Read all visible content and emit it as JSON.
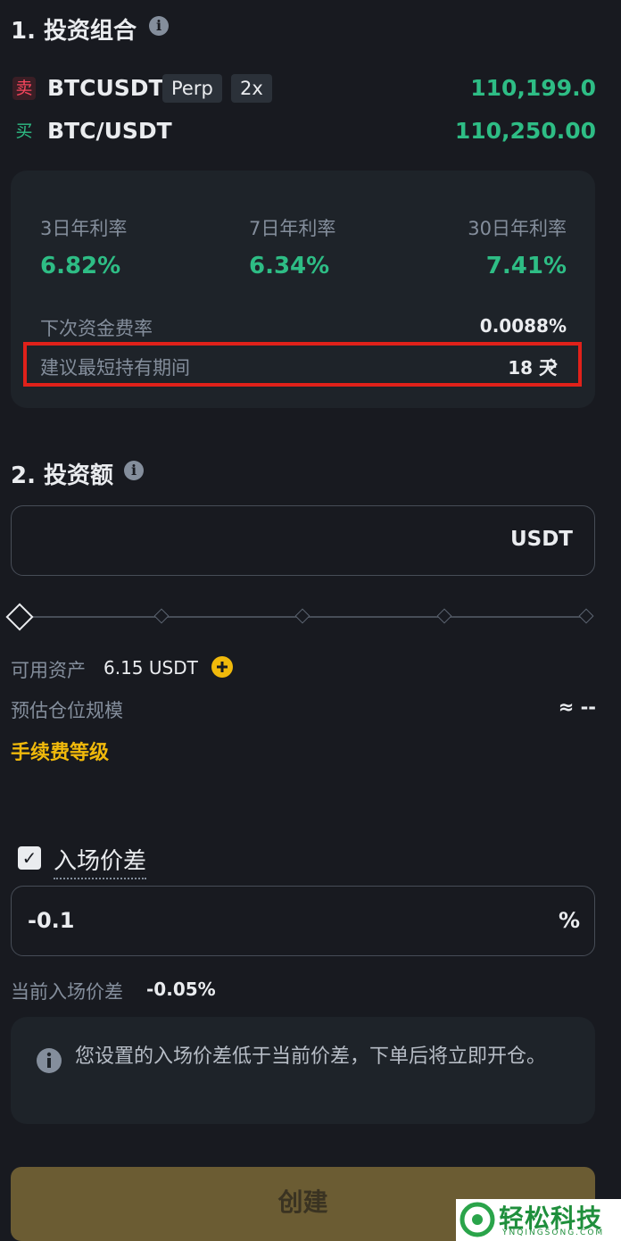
{
  "section1": {
    "title": "1. 投资组合"
  },
  "legs": [
    {
      "side": "卖",
      "symbol": "BTCUSDT",
      "type_chip": "Perp",
      "leverage_chip": "2x",
      "price": "110,199.0"
    },
    {
      "side": "买",
      "symbol": "BTC/USDT",
      "price": "110,250.00"
    }
  ],
  "rates": {
    "items": [
      {
        "label": "3日年利率",
        "value": "6.82%"
      },
      {
        "label": "7日年利率",
        "value": "6.34%"
      },
      {
        "label": "30日年利率",
        "value": "7.41%"
      }
    ],
    "next_funding_label": "下次资金费率",
    "next_funding_value": "0.0088%",
    "min_hold_label": "建议最短持有期间",
    "min_hold_value": "18 天"
  },
  "section2": {
    "title": "2. 投资额"
  },
  "amount_input": {
    "value": "",
    "unit": "USDT"
  },
  "available": {
    "label": "可用资产",
    "value": "6.15 USDT"
  },
  "position_size": {
    "label": "预估仓位规模",
    "value": "≈ --"
  },
  "fee_tier_link": "手续费等级",
  "entry_spread": {
    "checkbox_label": "入场价差",
    "checked": true,
    "input_value": "-0.1",
    "unit": "%",
    "current_label": "当前入场价差",
    "current_value": "-0.05%"
  },
  "notice": "您设置的入场价差低于当前价差，下单后将立即开仓。",
  "create_button": "创建",
  "watermark": {
    "brand": "轻松科技",
    "domain": "YNQINGSONG.COM"
  },
  "colors": {
    "accent": "#f0b90b",
    "up": "#2ebd85",
    "down": "#f6465d",
    "highlight": "#e0211a"
  }
}
